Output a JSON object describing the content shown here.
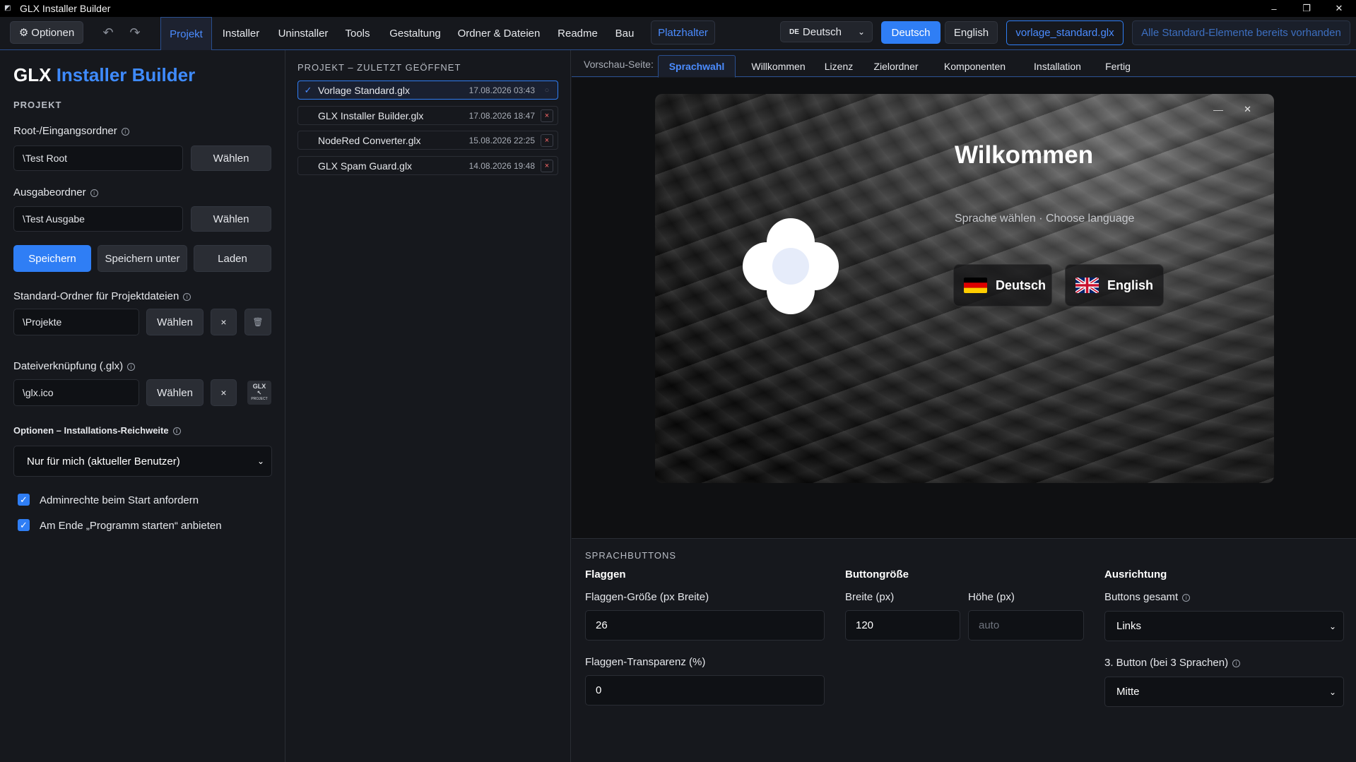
{
  "window": {
    "title": "GLX Installer Builder",
    "minimize": "–",
    "maximize": "❐",
    "close": "✕"
  },
  "toolbar": {
    "options_label": "Optionen",
    "undo": "↶",
    "redo": "↷",
    "tabs": [
      {
        "label": "Projekt",
        "active": true
      },
      {
        "label": "Installer"
      },
      {
        "label": "Uninstaller"
      },
      {
        "label": "Tools"
      },
      {
        "label": "Gestaltung"
      },
      {
        "label": "Ordner & Dateien"
      },
      {
        "label": "Readme"
      },
      {
        "label": "Bau"
      }
    ],
    "placeholder_label": "Platzhalter",
    "language_select": {
      "code": "DE",
      "value": "Deutsch"
    },
    "deutsch_label": "Deutsch",
    "english_label": "English",
    "file_label": "vorlage_standard.glx",
    "standard_label": "Alle Standard-Elemente bereits vorhanden"
  },
  "left": {
    "brand_prefix": "GLX",
    "brand_accent": "Installer Builder",
    "section_title": "PROJEKT",
    "root_label": "Root-/Eingangsordner",
    "root_value": "\\Test Root",
    "choose_label": "Wählen",
    "output_label": "Ausgabeordner",
    "output_value": "\\Test Ausgabe",
    "save_label": "Speichern",
    "save_as_label": "Speichern unter",
    "load_label": "Laden",
    "std_folder_label": "Standard-Ordner für Projektdateien",
    "std_folder_value": "\\Projekte",
    "clear_label": "×",
    "delete_icon": "🗑",
    "link_label": "Dateiverknüpfung (.glx)",
    "link_value": "\\glx.ico",
    "glx_icon_text": "GLX",
    "glx_icon_sub": "PROJECT",
    "options_title": "Optionen – Installations-Reichweite",
    "scope_value": "Nur für mich (aktueller Benutzer)",
    "check1": "Adminrechte beim Start anfordern",
    "check2": "Am Ende „Programm starten“ anbieten",
    "checkmark": "✓"
  },
  "middle": {
    "title": "PROJEKT – ZULETZT GEÖFFNET",
    "recent": [
      {
        "name": "Vorlage Standard.glx",
        "date": "17.08.2026 03:43",
        "active": true
      },
      {
        "name": "GLX Installer Builder.glx",
        "date": "17.08.2026 18:47"
      },
      {
        "name": "NodeRed Converter.glx",
        "date": "15.08.2026 22:25"
      },
      {
        "name": "GLX Spam Guard.glx",
        "date": "14.08.2026 19:48"
      }
    ]
  },
  "preview": {
    "label": "Vorschau-Seite:",
    "tabs": [
      "Sprachwahl",
      "Willkommen",
      "Lizenz",
      "Zielordner",
      "Komponenten",
      "Installation",
      "Fertig"
    ],
    "welcome": "Wilkommen",
    "choose_language": "Sprache wählen · Choose language",
    "btn_de": "Deutsch",
    "btn_en": "English"
  },
  "settings": {
    "title": "SPRACHBUTTONS",
    "flags_head": "Flaggen",
    "flag_size_label": "Flaggen-Größe (px Breite)",
    "flag_size_value": "26",
    "flag_opacity_label": "Flaggen-Transparenz (%)",
    "flag_opacity_value": "0",
    "size_head": "Buttongröße",
    "width_label": "Breite (px)",
    "width_value": "120",
    "height_label": "Höhe (px)",
    "height_placeholder": "auto",
    "align_head": "Ausrichtung",
    "buttons_total_label": "Buttons gesamt",
    "buttons_total_value": "Links",
    "third_button_label": "3. Button (bei 3 Sprachen)",
    "third_button_value": "Mitte"
  },
  "colors": {
    "accent": "#2f7ef5",
    "link": "#4b8cff",
    "background": "#16181d",
    "danger": "#ff6a6a"
  }
}
